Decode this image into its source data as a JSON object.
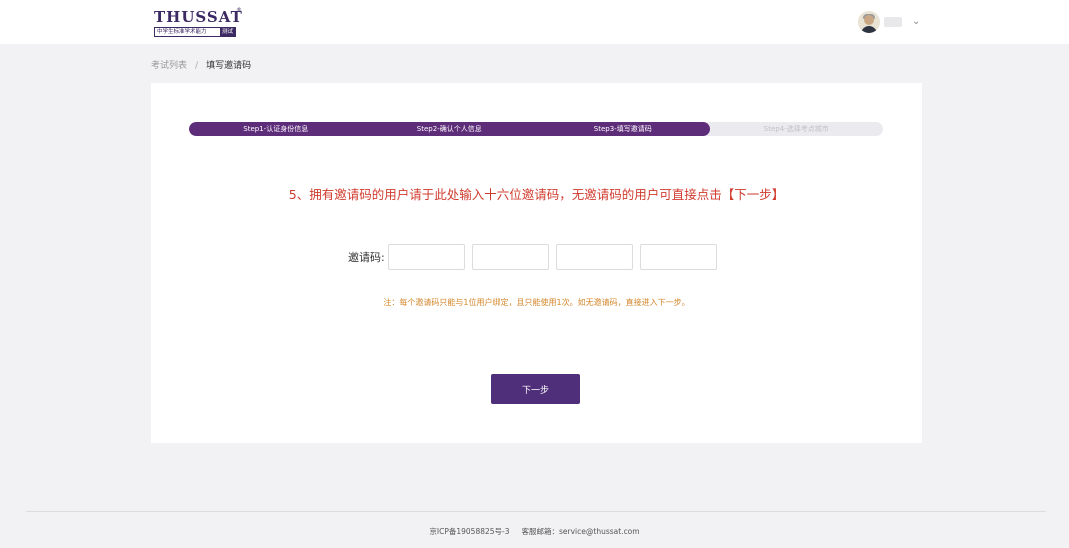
{
  "header": {
    "logo": {
      "word": "THUSSAT",
      "registered": "®",
      "subtitle": "中学生标准学术能力",
      "subtitle_tag": "测试"
    },
    "user": {
      "avatar_icon": "user-avatar-icon",
      "menu_icon": "chevron-down-icon",
      "chevron_glyph": "⌄"
    }
  },
  "breadcrumb": {
    "items": [
      "考试列表",
      "填写邀请码"
    ],
    "separator": "/"
  },
  "steps": {
    "items": [
      {
        "label": "Step1-认证身份信息",
        "done": true
      },
      {
        "label": "Step2-确认个人信息",
        "done": true
      },
      {
        "label": "Step3-填写邀请码",
        "done": true
      },
      {
        "label": "Step4-选择考点城市",
        "done": false
      }
    ],
    "active_color": "#5e2d7a",
    "inactive_color": "#ebebef"
  },
  "prompt": "5、拥有邀请码的用户请于此处输入十六位邀请码，无邀请码的用户可直接点击【下一步】",
  "code": {
    "label": "邀请码:",
    "fields": [
      {
        "value": "",
        "placeholder": ""
      },
      {
        "value": "",
        "placeholder": ""
      },
      {
        "value": "",
        "placeholder": ""
      },
      {
        "value": "",
        "placeholder": ""
      }
    ]
  },
  "note": "注：每个邀请码只能与1位用户绑定，且只能使用1次。如无邀请码，直接进入下一步。",
  "next_button": "下一步",
  "footer": {
    "icp": "京ICP备19058825号-3",
    "service_email": "客服邮箱：service@thussat.com"
  },
  "colors": {
    "brand": "#4f2f7a",
    "prompt": "#d03b2e",
    "note": "#d4862a"
  }
}
